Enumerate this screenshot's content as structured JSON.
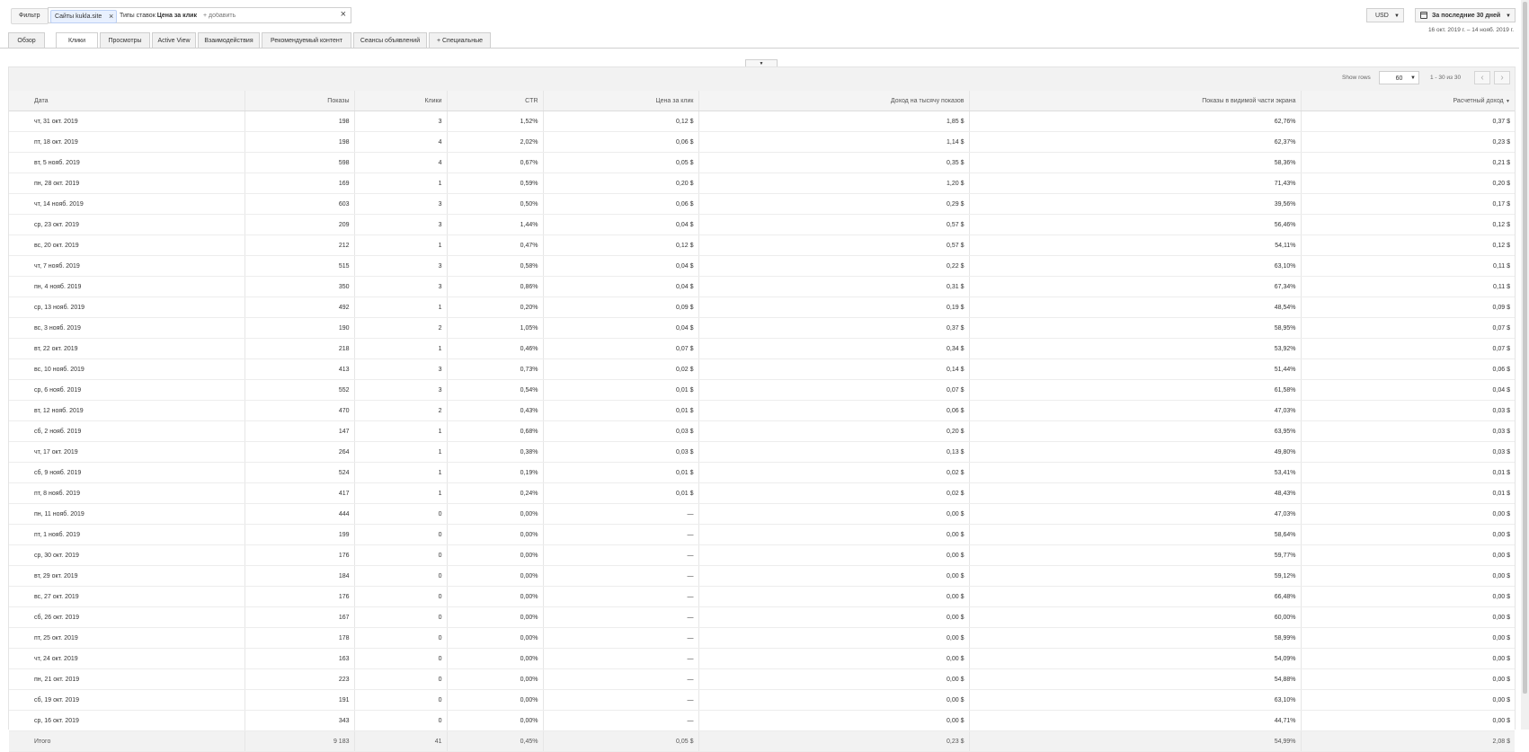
{
  "filterbar": {
    "filter_label": "Фильтр",
    "chip_sites": "Сайты kukla.site",
    "chip_bid_prefix": "Типы ставок",
    "chip_bid_value": "Цена за клик",
    "add_placeholder": "+ добавить"
  },
  "currency": {
    "value": "USD"
  },
  "period": {
    "label": "За последние 30 дней",
    "range": "16 окт. 2019 г. – 14 нояб. 2019 г."
  },
  "tabs": [
    {
      "label": "Обзор"
    },
    {
      "label": "Клики",
      "active": true
    },
    {
      "label": "Просмотры"
    },
    {
      "label": "Active View"
    },
    {
      "label": "Взаимодействия"
    },
    {
      "label": "Рекомендуемый контент"
    },
    {
      "label": "Сеансы объявлений"
    },
    {
      "label": "+ Специальные"
    }
  ],
  "pagination": {
    "show_rows_label": "Show rows",
    "rows_value": "60",
    "range_text": "1 - 30 из 30"
  },
  "table": {
    "columns": [
      "Дата",
      "Показы",
      "Клики",
      "CTR",
      "Цена за клик",
      "Доход на тысячу показов",
      "Показы в видимой части экрана",
      "Расчетный доход"
    ],
    "sorted_column": 7,
    "rows": [
      [
        "чт, 31 окт. 2019",
        "198",
        "3",
        "1,52%",
        "0,12 $",
        "1,85 $",
        "62,76%",
        "0,37 $"
      ],
      [
        "пт, 18 окт. 2019",
        "198",
        "4",
        "2,02%",
        "0,06 $",
        "1,14 $",
        "62,37%",
        "0,23 $"
      ],
      [
        "вт, 5 нояб. 2019",
        "598",
        "4",
        "0,67%",
        "0,05 $",
        "0,35 $",
        "58,36%",
        "0,21 $"
      ],
      [
        "пн, 28 окт. 2019",
        "169",
        "1",
        "0,59%",
        "0,20 $",
        "1,20 $",
        "71,43%",
        "0,20 $"
      ],
      [
        "чт, 14 нояб. 2019",
        "603",
        "3",
        "0,50%",
        "0,06 $",
        "0,29 $",
        "39,56%",
        "0,17 $"
      ],
      [
        "ср, 23 окт. 2019",
        "209",
        "3",
        "1,44%",
        "0,04 $",
        "0,57 $",
        "56,46%",
        "0,12 $"
      ],
      [
        "вс, 20 окт. 2019",
        "212",
        "1",
        "0,47%",
        "0,12 $",
        "0,57 $",
        "54,11%",
        "0,12 $"
      ],
      [
        "чт, 7 нояб. 2019",
        "515",
        "3",
        "0,58%",
        "0,04 $",
        "0,22 $",
        "63,10%",
        "0,11 $"
      ],
      [
        "пн, 4 нояб. 2019",
        "350",
        "3",
        "0,86%",
        "0,04 $",
        "0,31 $",
        "67,34%",
        "0,11 $"
      ],
      [
        "ср, 13 нояб. 2019",
        "492",
        "1",
        "0,20%",
        "0,09 $",
        "0,19 $",
        "48,54%",
        "0,09 $"
      ],
      [
        "вс, 3 нояб. 2019",
        "190",
        "2",
        "1,05%",
        "0,04 $",
        "0,37 $",
        "58,95%",
        "0,07 $"
      ],
      [
        "вт, 22 окт. 2019",
        "218",
        "1",
        "0,46%",
        "0,07 $",
        "0,34 $",
        "53,92%",
        "0,07 $"
      ],
      [
        "вс, 10 нояб. 2019",
        "413",
        "3",
        "0,73%",
        "0,02 $",
        "0,14 $",
        "51,44%",
        "0,06 $"
      ],
      [
        "ср, 6 нояб. 2019",
        "552",
        "3",
        "0,54%",
        "0,01 $",
        "0,07 $",
        "61,58%",
        "0,04 $"
      ],
      [
        "вт, 12 нояб. 2019",
        "470",
        "2",
        "0,43%",
        "0,01 $",
        "0,06 $",
        "47,03%",
        "0,03 $"
      ],
      [
        "сб, 2 нояб. 2019",
        "147",
        "1",
        "0,68%",
        "0,03 $",
        "0,20 $",
        "63,95%",
        "0,03 $"
      ],
      [
        "чт, 17 окт. 2019",
        "264",
        "1",
        "0,38%",
        "0,03 $",
        "0,13 $",
        "49,80%",
        "0,03 $"
      ],
      [
        "сб, 9 нояб. 2019",
        "524",
        "1",
        "0,19%",
        "0,01 $",
        "0,02 $",
        "53,41%",
        "0,01 $"
      ],
      [
        "пт, 8 нояб. 2019",
        "417",
        "1",
        "0,24%",
        "0,01 $",
        "0,02 $",
        "48,43%",
        "0,01 $"
      ],
      [
        "пн, 11 нояб. 2019",
        "444",
        "0",
        "0,00%",
        "—",
        "0,00 $",
        "47,03%",
        "0,00 $"
      ],
      [
        "пт, 1 нояб. 2019",
        "199",
        "0",
        "0,00%",
        "—",
        "0,00 $",
        "58,64%",
        "0,00 $"
      ],
      [
        "ср, 30 окт. 2019",
        "176",
        "0",
        "0,00%",
        "—",
        "0,00 $",
        "59,77%",
        "0,00 $"
      ],
      [
        "вт, 29 окт. 2019",
        "184",
        "0",
        "0,00%",
        "—",
        "0,00 $",
        "59,12%",
        "0,00 $"
      ],
      [
        "вс, 27 окт. 2019",
        "176",
        "0",
        "0,00%",
        "—",
        "0,00 $",
        "66,48%",
        "0,00 $"
      ],
      [
        "сб, 26 окт. 2019",
        "167",
        "0",
        "0,00%",
        "—",
        "0,00 $",
        "60,00%",
        "0,00 $"
      ],
      [
        "пт, 25 окт. 2019",
        "178",
        "0",
        "0,00%",
        "—",
        "0,00 $",
        "58,99%",
        "0,00 $"
      ],
      [
        "чт, 24 окт. 2019",
        "163",
        "0",
        "0,00%",
        "—",
        "0,00 $",
        "54,09%",
        "0,00 $"
      ],
      [
        "пн, 21 окт. 2019",
        "223",
        "0",
        "0,00%",
        "—",
        "0,00 $",
        "54,88%",
        "0,00 $"
      ],
      [
        "сб, 19 окт. 2019",
        "191",
        "0",
        "0,00%",
        "—",
        "0,00 $",
        "63,10%",
        "0,00 $"
      ],
      [
        "ср, 16 окт. 2019",
        "343",
        "0",
        "0,00%",
        "—",
        "0,00 $",
        "44,71%",
        "0,00 $"
      ]
    ],
    "total": [
      "Итого",
      "9 183",
      "41",
      "0,45%",
      "0,05 $",
      "0,23 $",
      "54,99%",
      "2,08 $"
    ]
  }
}
